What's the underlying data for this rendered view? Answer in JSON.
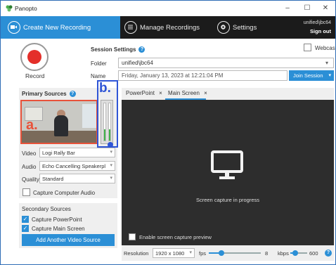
{
  "window": {
    "title": "Panopto",
    "minimize": "–",
    "maximize": "☐",
    "close": "✕"
  },
  "nav": {
    "create": "Create New Recording",
    "manage": "Manage Recordings",
    "settings": "Settings",
    "user": "unified\\jbc64",
    "sign_out": "Sign out"
  },
  "record": {
    "label": "Record"
  },
  "session": {
    "title": "Session Settings",
    "info": "?",
    "webcast": "Webcast",
    "folder_label": "Folder",
    "folder_value": "unified\\jbc64",
    "name_label": "Name",
    "name_value": "Friday, January 13, 2023 at 12:21:04 PM",
    "join": "Join Session"
  },
  "primary": {
    "title": "Primary Sources",
    "info": "?",
    "annotation_a": "a.",
    "annotation_b": "b.",
    "video_label": "Video",
    "video_value": "Logi Rally Bar",
    "audio_label": "Audio",
    "audio_value": "Echo Cancelling Speakerpl",
    "quality_label": "Quality",
    "quality_value": "Standard",
    "capture_audio": "Capture Computer Audio",
    "audio_level": 0.3
  },
  "secondary": {
    "title": "Secondary Sources",
    "ppt": "Capture PowerPoint",
    "screen": "Capture Main Screen",
    "add": "Add Another Video Source"
  },
  "preview": {
    "tab_ppt": "PowerPoint",
    "tab_main": "Main Screen",
    "tab_close": "×",
    "status": "Screen capture in progress",
    "enable_preview": "Enable screen capture preview"
  },
  "bottom": {
    "resolution_label": "Resolution",
    "resolution_value": "1920 x 1080",
    "fps_label": "fps",
    "fps_value": "8",
    "kbps_label": "kbps",
    "kbps_value": "600",
    "help": "?"
  },
  "colors": {
    "accent": "#2b8fd6",
    "record": "#e42f2a",
    "annotation_a": "#e8523a",
    "annotation_b": "#2f55d6"
  }
}
